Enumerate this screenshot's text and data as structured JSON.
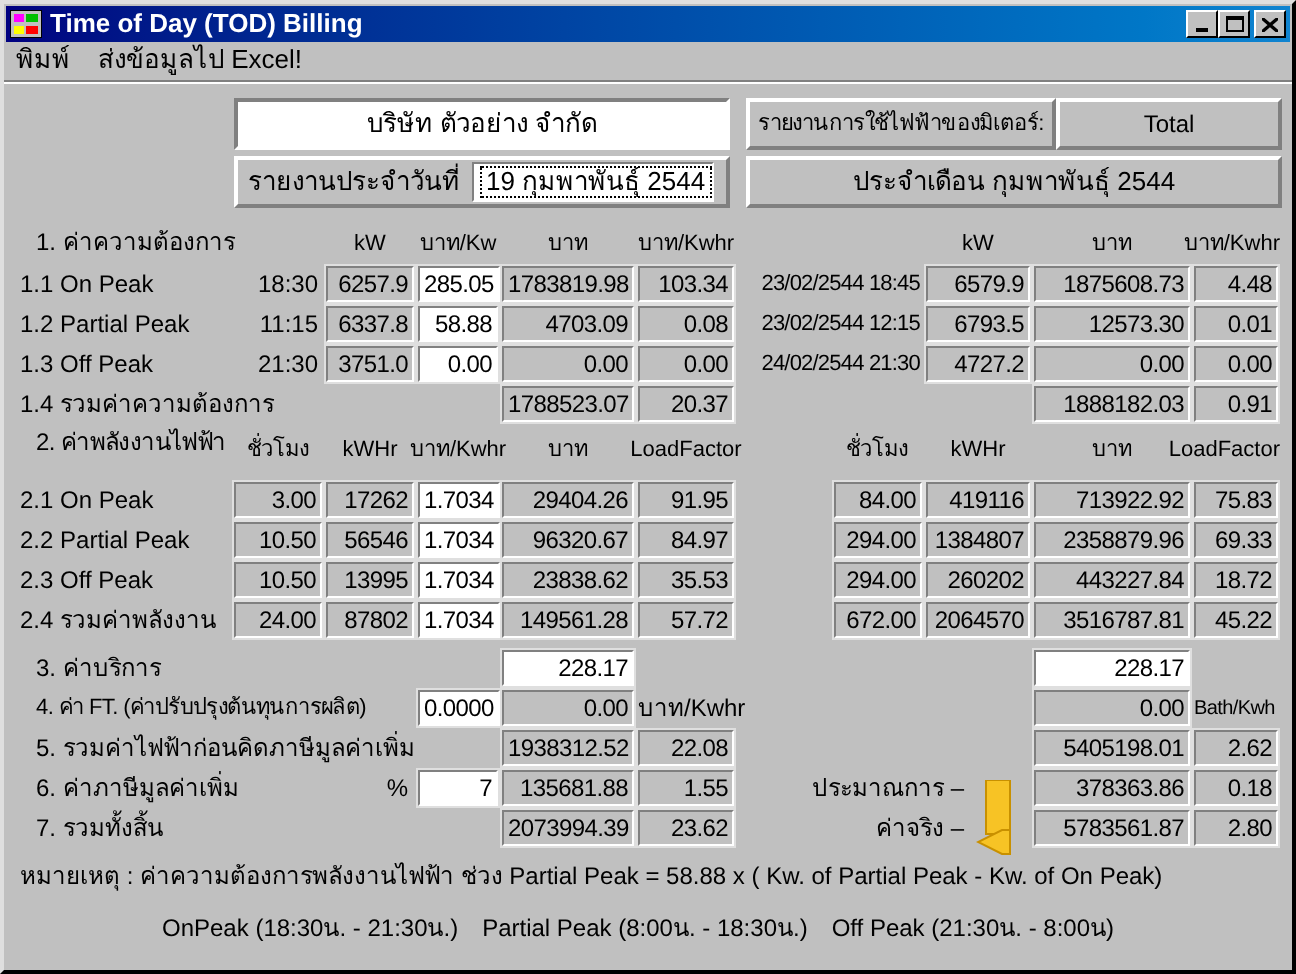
{
  "window": {
    "title": "Time of Day (TOD) Billing"
  },
  "menu": [
    "พิมพ์",
    "ส่งข้อมูลไป Excel!"
  ],
  "header": {
    "company": "บริษัท ตัวอย่าง จำกัด",
    "meter_label": "รายงานการใช้ไฟฟ้าของมิเตอร์:",
    "meter": "Total",
    "date_label": "รายงานประจำวันที่",
    "date": "19 กุมพาพันธุ์ 2544",
    "month": "ประจำเดือน กุมพาพันธุ์ 2544"
  },
  "demand": {
    "title": "1. ค่าความต้องการ",
    "columns": [
      "kW",
      "บาท/Kw",
      "บาท",
      "บาท/Kwhr"
    ],
    "monthly_columns": [
      "kW",
      "บาท",
      "บาท/Kwhr"
    ],
    "rows": [
      {
        "label": "1.1  On Peak",
        "time": "18:30",
        "kw": "6257.9",
        "rate": "285.05",
        "baht": "1783819.98",
        "per_kwhr": "103.34",
        "month_time": "23/02/2544 18:45",
        "month_kw": "6579.9",
        "month_baht": "1875608.73",
        "month_per_kwhr": "4.48"
      },
      {
        "label": "1.2  Partial  Peak",
        "time": "11:15",
        "kw": "6337.8",
        "rate": "58.88",
        "baht": "4703.09",
        "per_kwhr": "0.08",
        "month_time": "23/02/2544 12:15",
        "month_kw": "6793.5",
        "month_baht": "12573.30",
        "month_per_kwhr": "0.01"
      },
      {
        "label": "1.3  Off Peak",
        "time": "21:30",
        "kw": "3751.0",
        "rate": "0.00",
        "baht": "0.00",
        "per_kwhr": "0.00",
        "month_time": "24/02/2544 21:30",
        "month_kw": "4727.2",
        "month_baht": "0.00",
        "month_per_kwhr": "0.00"
      }
    ],
    "total": {
      "label": "1.4  รวมค่าความต้องการ",
      "baht": "1788523.07",
      "per_kwhr": "20.37",
      "month_baht": "1888182.03",
      "month_per_kwhr": "0.91"
    }
  },
  "energy": {
    "title": "2. ค่าพลังงานไฟฟ้า",
    "columns": [
      "ชั่วโมง",
      "kWHr",
      "บาท/Kwhr",
      "บาท",
      "LoadFactor"
    ],
    "monthly_columns": [
      "ชั่วโมง",
      "kWHr",
      "บาท",
      "LoadFactor"
    ],
    "rows": [
      {
        "label": "2.1  On Peak",
        "hours": "3.00",
        "kwhr": "17262",
        "rate": "1.7034",
        "baht": "29404.26",
        "load_factor": "91.95",
        "month_hours": "84.00",
        "month_kwhr": "419116",
        "month_baht": "713922.92",
        "month_load_factor": "75.83"
      },
      {
        "label": "2.2  Partial  Peak",
        "hours": "10.50",
        "kwhr": "56546",
        "rate": "1.7034",
        "baht": "96320.67",
        "load_factor": "84.97",
        "month_hours": "294.00",
        "month_kwhr": "1384807",
        "month_baht": "2358879.96",
        "month_load_factor": "69.33"
      },
      {
        "label": "2.3  Off Peak",
        "hours": "10.50",
        "kwhr": "13995",
        "rate": "1.7034",
        "baht": "23838.62",
        "load_factor": "35.53",
        "month_hours": "294.00",
        "month_kwhr": "260202",
        "month_baht": "443227.84",
        "month_load_factor": "18.72"
      },
      {
        "label": "2.4  รวมค่าพลังงาน",
        "hours": "24.00",
        "kwhr": "87802",
        "rate": "1.7034",
        "baht": "149561.28",
        "load_factor": "57.72",
        "month_hours": "672.00",
        "month_kwhr": "2064570",
        "month_baht": "3516787.81",
        "month_load_factor": "45.22"
      }
    ]
  },
  "summary": [
    {
      "kind": "service",
      "label": "3. ค่าบริการ",
      "baht": "228.17",
      "month_baht": "228.17"
    },
    {
      "kind": "ft",
      "label": "4. ค่า FT. (ค่าปรับปรุงต้นทุนการผลิต)",
      "input": "0.0000",
      "baht": "0.00",
      "unit": "บาท/Kwhr",
      "month_baht": "0.00",
      "month_unit": "Bath/Kwh"
    },
    {
      "kind": "total",
      "label": "5. รวมค่าไฟฟ้าก่อนคิดภาษีมูลค่าเพิ่ม",
      "baht": "1938312.52",
      "per_kwhr": "22.08",
      "month_baht": "5405198.01",
      "month_per_kwhr": "2.62"
    },
    {
      "kind": "vat",
      "label": "6. ค่าภาษีมูลค่าเพิ่ม",
      "symbol": "%",
      "input": "7",
      "baht": "135681.88",
      "per_kwhr": "1.55",
      "note": "ประมาณการ –",
      "month_baht": "378363.86",
      "month_per_kwhr": "0.18"
    },
    {
      "kind": "total",
      "label": "7. รวมทั้งสิ้น",
      "baht": "2073994.39",
      "per_kwhr": "23.62",
      "note": "ค่าจริง –",
      "month_baht": "5783561.87",
      "month_per_kwhr": "2.80"
    }
  ],
  "remark": "หมายเหตุ :  ค่าความต้องการพลังงานไฟฟ้า ช่วง Partial Peak  =  58.88 x ( Kw. of Partial Peak - Kw. of On Peak)",
  "periods": [
    "OnPeak (18:30น. - 21:30น.)",
    "Partial Peak (8:00น. - 18:30น.)",
    "Off Peak (21:30น. - 8:00น)"
  ]
}
